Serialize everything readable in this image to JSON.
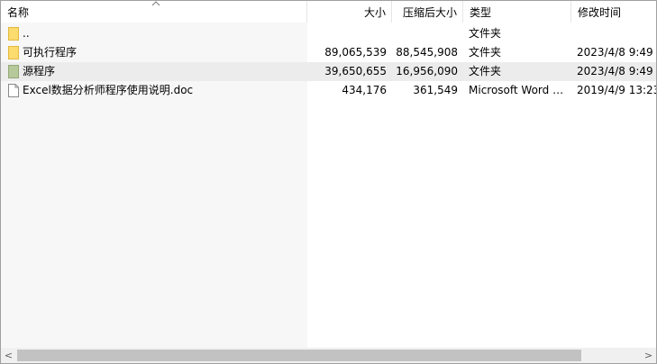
{
  "header": {
    "name": "名称",
    "size": "大小",
    "packed_size": "压缩后大小",
    "type": "类型",
    "modified": "修改时间",
    "sort_icon": "chevron-up-icon"
  },
  "rows": [
    {
      "icon": "folder-icon",
      "name": "..",
      "size": "",
      "packed": "",
      "type": "文件夹",
      "modified": ""
    },
    {
      "icon": "folder-icon",
      "name": "可执行程序",
      "size": "89,065,539",
      "packed": "88,545,908",
      "type": "文件夹",
      "modified": "2023/4/8 9:49"
    },
    {
      "icon": "folder-icon",
      "name": "源程序",
      "size": "39,650,655",
      "packed": "16,956,090",
      "type": "文件夹",
      "modified": "2023/4/8 9:49"
    },
    {
      "icon": "document-icon",
      "name": "Excel数据分析师程序使用说明.doc",
      "size": "434,176",
      "packed": "361,549",
      "type": "Microsoft Word …",
      "modified": "2019/4/9 13:23"
    }
  ],
  "scrollbar": {
    "left_icon": "chevron-left-icon",
    "right_icon": "chevron-right-icon",
    "left_glyph": "<",
    "right_glyph": ">"
  },
  "colors": {
    "folder": "#fcdb6f",
    "folder_selected": "#b5c99a",
    "selected_row": "#ececec",
    "name_column_bg": "#f7f7f7"
  }
}
